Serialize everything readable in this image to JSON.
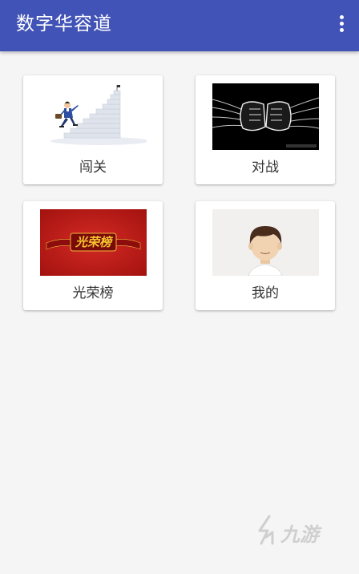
{
  "app": {
    "title": "数字华容道"
  },
  "menu": {
    "icon": "overflow-menu-icon"
  },
  "cards": [
    {
      "label": "闯关",
      "image": "stairs-climber-illustration"
    },
    {
      "label": "对战",
      "image": "fist-bump-illustration"
    },
    {
      "label": "光荣榜",
      "image": "honor-banner-illustration"
    },
    {
      "label": "我的",
      "image": "avatar-illustration"
    }
  ],
  "honor_banner_text": "光荣榜",
  "watermark_text": "九游",
  "colors": {
    "appbar": "#4153b6",
    "background": "#f5f5f5",
    "card": "#ffffff",
    "banner_red": "#c0201f",
    "banner_gold": "#f4c430"
  }
}
